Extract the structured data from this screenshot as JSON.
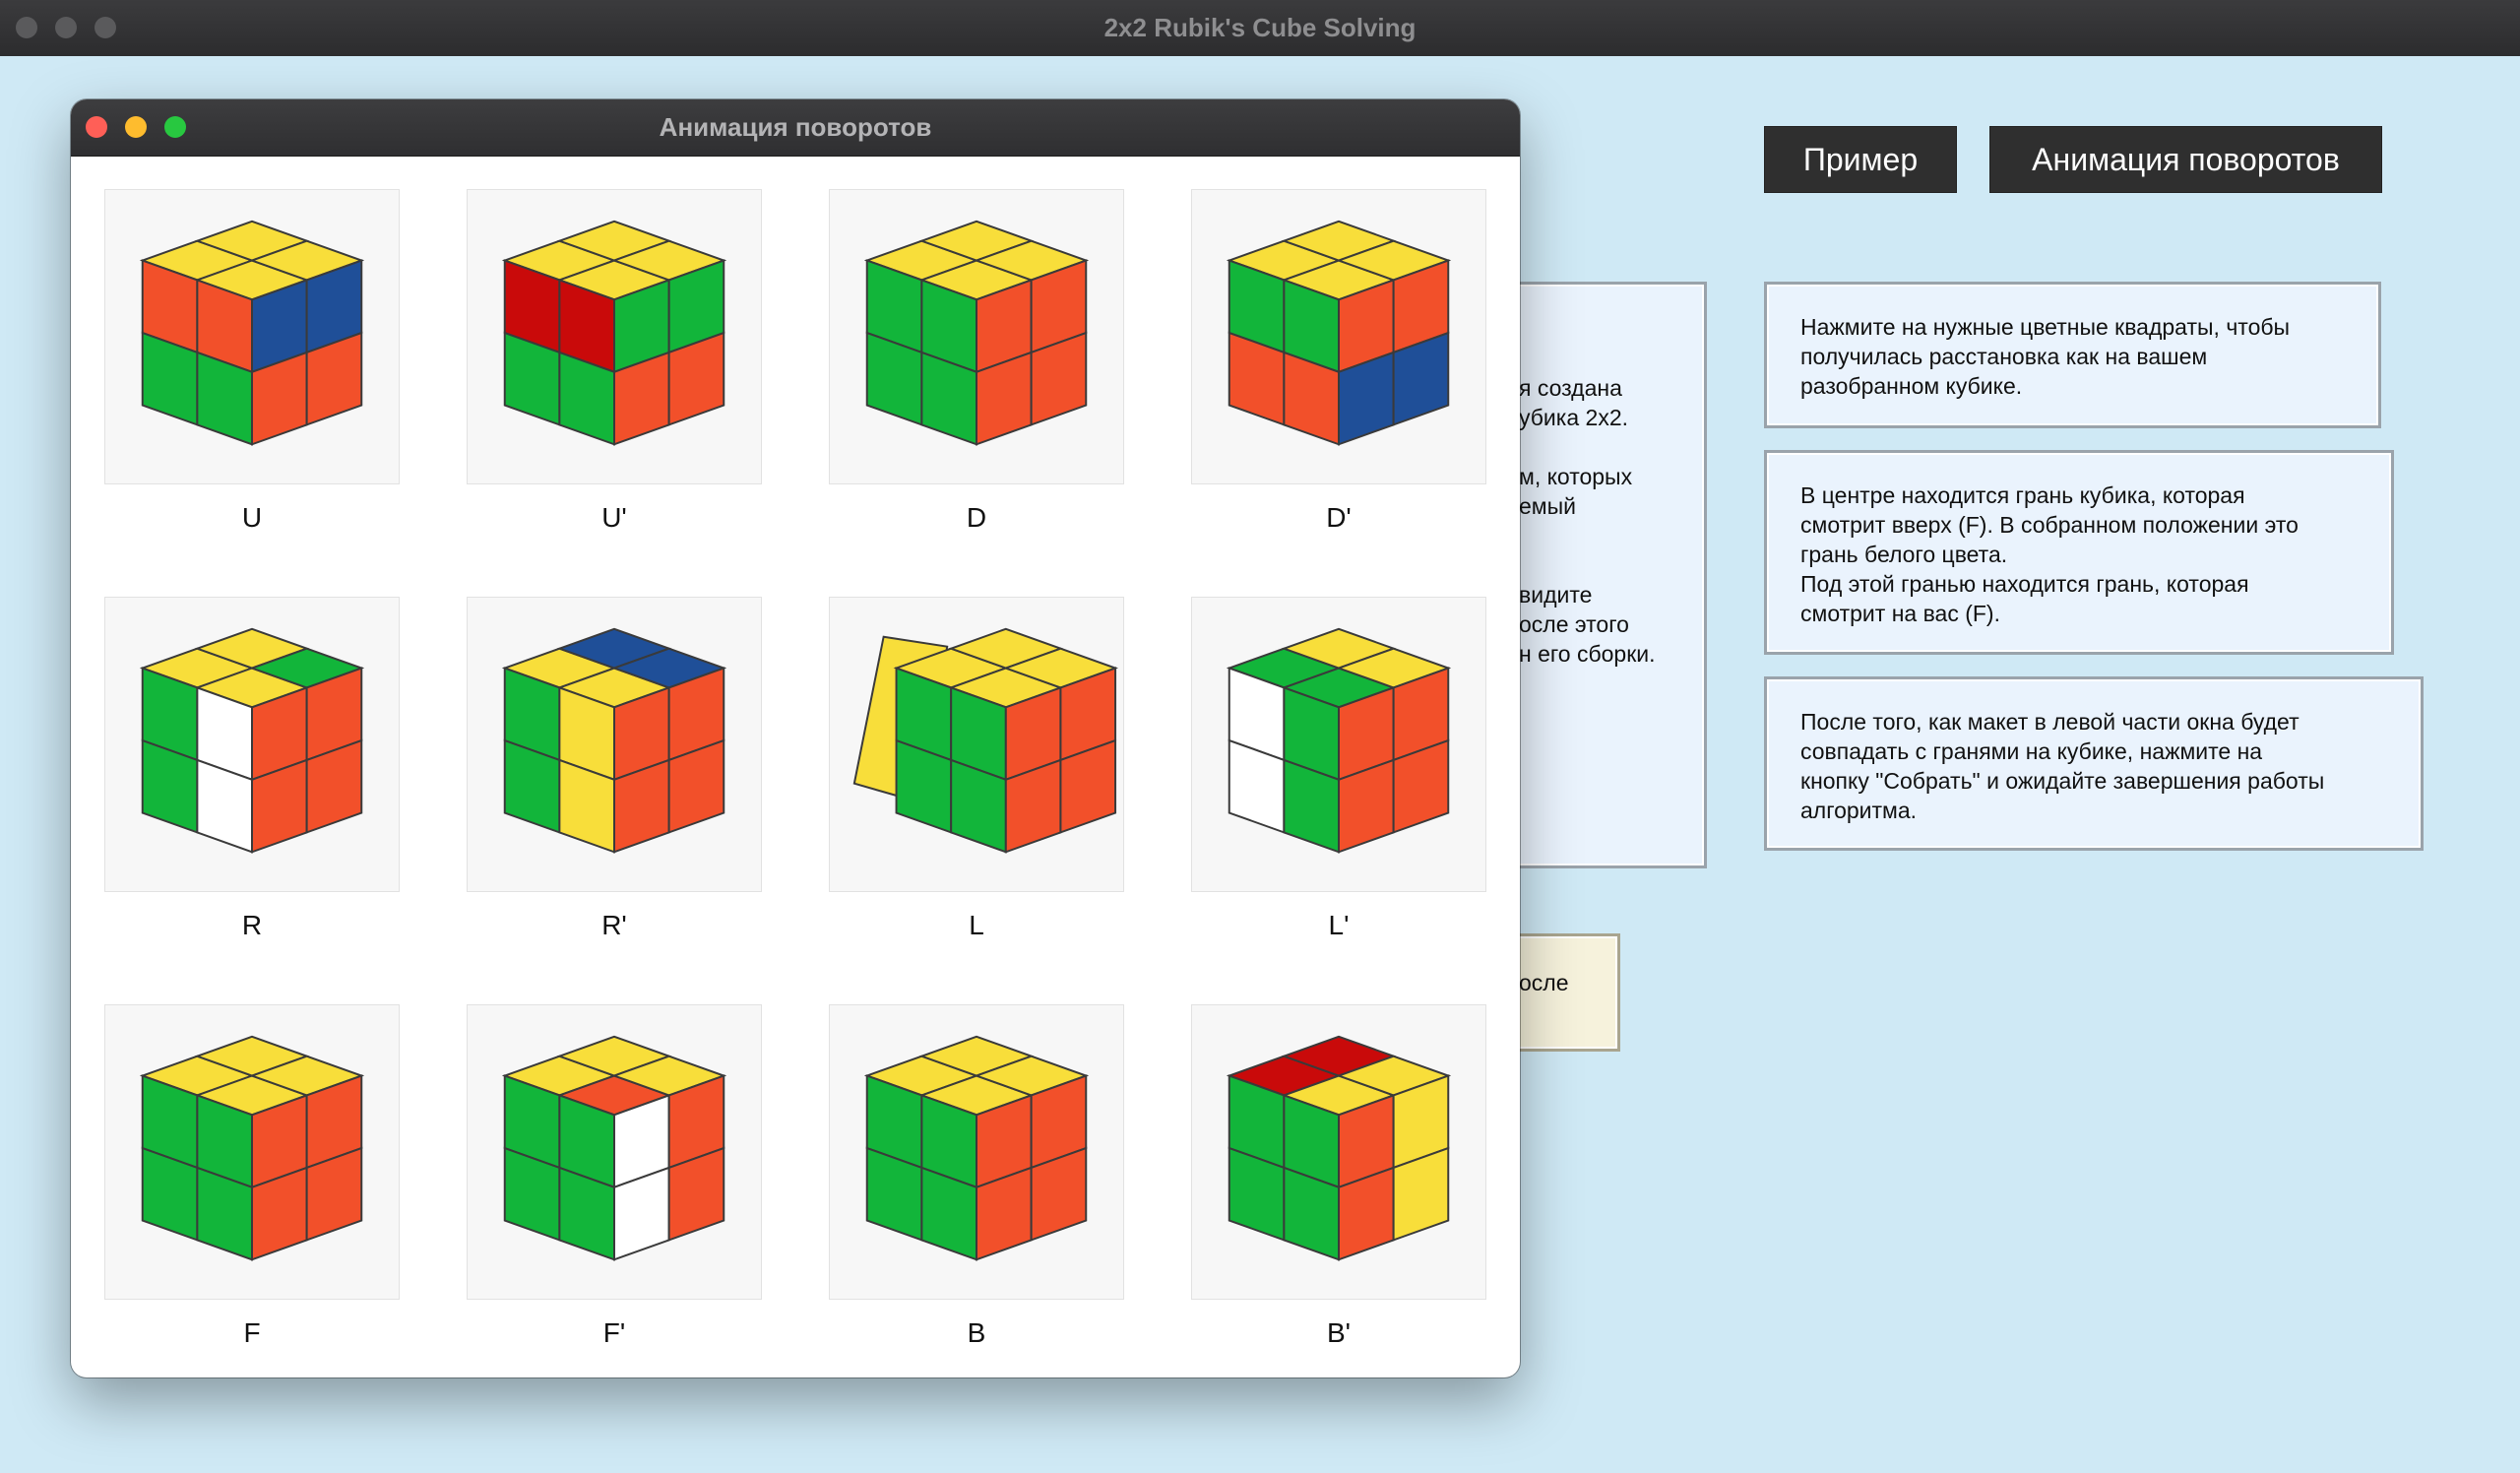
{
  "main_window": {
    "title": "2x2 Rubik's Cube Solving"
  },
  "buttons": {
    "example": "Пример",
    "animation": "Анимация поворотов"
  },
  "info_boxes": [
    "Нажмите на нужные цветные квадраты, чтобы\nполучилась расстановка как на вашем\nразобранном кубике.",
    "В центре находится грань кубика, которая\nсмотрит вверх (F). В собранном положении это\nгрань белого цвета.\nПод этой гранью находится грань, которая\nсмотрит на вас (F).",
    "После того, как макет в левой части окна будет\nсовпадать с гранями на кубике, нажмите на\nкнопку \"Собрать\" и ожидайте завершения работы\nалгоритма."
  ],
  "hidden_panel_fragments": [
    "я создана\nубика 2x2.",
    "м, которых\nемый",
    "видите\nосле этого\nн его сборки."
  ],
  "hidden_note_fragment": "осле",
  "animation_window": {
    "title": "Анимация поворотов",
    "moves": [
      {
        "label": "U",
        "top": [
          "Y",
          "Y",
          "Y",
          "Y"
        ],
        "front": [
          "O",
          "O",
          "G",
          "G"
        ],
        "right": [
          "B",
          "B",
          "R",
          "R"
        ]
      },
      {
        "label": "U'",
        "top": [
          "Y",
          "Y",
          "Y",
          "Y"
        ],
        "front": [
          "D",
          "D",
          "G",
          "G"
        ],
        "right": [
          "G",
          "G",
          "R",
          "R"
        ]
      },
      {
        "label": "D",
        "top": [
          "Y",
          "Y",
          "Y",
          "Y"
        ],
        "front": [
          "G",
          "G",
          "G",
          "G"
        ],
        "right": [
          "R",
          "R",
          "R",
          "R"
        ]
      },
      {
        "label": "D'",
        "top": [
          "Y",
          "Y",
          "Y",
          "Y"
        ],
        "front": [
          "G",
          "G",
          "O",
          "O"
        ],
        "right": [
          "R",
          "R",
          "B",
          "B"
        ]
      },
      {
        "label": "R",
        "top": [
          "Y",
          "Y",
          "Y",
          "G"
        ],
        "front": [
          "G",
          "W",
          "G",
          "W"
        ],
        "right": [
          "R",
          "R",
          "R",
          "R"
        ]
      },
      {
        "label": "R'",
        "top": [
          "Y",
          "B",
          "Y",
          "B"
        ],
        "front": [
          "G",
          "Y",
          "G",
          "Y"
        ],
        "right": [
          "R",
          "R",
          "R",
          "R"
        ]
      },
      {
        "label": "L",
        "top": [
          "Y",
          "Y",
          "Y",
          "Y"
        ],
        "front": [
          "G",
          "G",
          "G",
          "G"
        ],
        "right": [
          "R",
          "R",
          "R",
          "R"
        ],
        "tilt": true
      },
      {
        "label": "L'",
        "top": [
          "G",
          "Y",
          "G",
          "Y"
        ],
        "front": [
          "W",
          "G",
          "W",
          "G"
        ],
        "right": [
          "R",
          "R",
          "R",
          "R"
        ]
      },
      {
        "label": "F",
        "top": [
          "Y",
          "Y",
          "Y",
          "Y"
        ],
        "front": [
          "G",
          "G",
          "G",
          "G"
        ],
        "right": [
          "R",
          "R",
          "R",
          "R"
        ]
      },
      {
        "label": "F'",
        "top": [
          "Y",
          "Y",
          "O",
          "Y"
        ],
        "front": [
          "G",
          "G",
          "G",
          "G"
        ],
        "right": [
          "W",
          "R",
          "W",
          "R"
        ]
      },
      {
        "label": "B",
        "top": [
          "Y",
          "Y",
          "Y",
          "Y"
        ],
        "front": [
          "G",
          "G",
          "G",
          "G"
        ],
        "right": [
          "R",
          "R",
          "R",
          "R"
        ]
      },
      {
        "label": "B'",
        "top": [
          "D",
          "D",
          "Y",
          "Y"
        ],
        "front": [
          "G",
          "G",
          "G",
          "G"
        ],
        "right": [
          "R",
          "Y",
          "R",
          "Y"
        ]
      }
    ]
  },
  "colors": {
    "background": "#cfe9f5",
    "Y": "#f8de3a",
    "G": "#12b53a",
    "R": "#f2502a",
    "O": "#f2502a",
    "B": "#1f4f98",
    "W": "#ffffff",
    "D": "#c90a0a"
  }
}
